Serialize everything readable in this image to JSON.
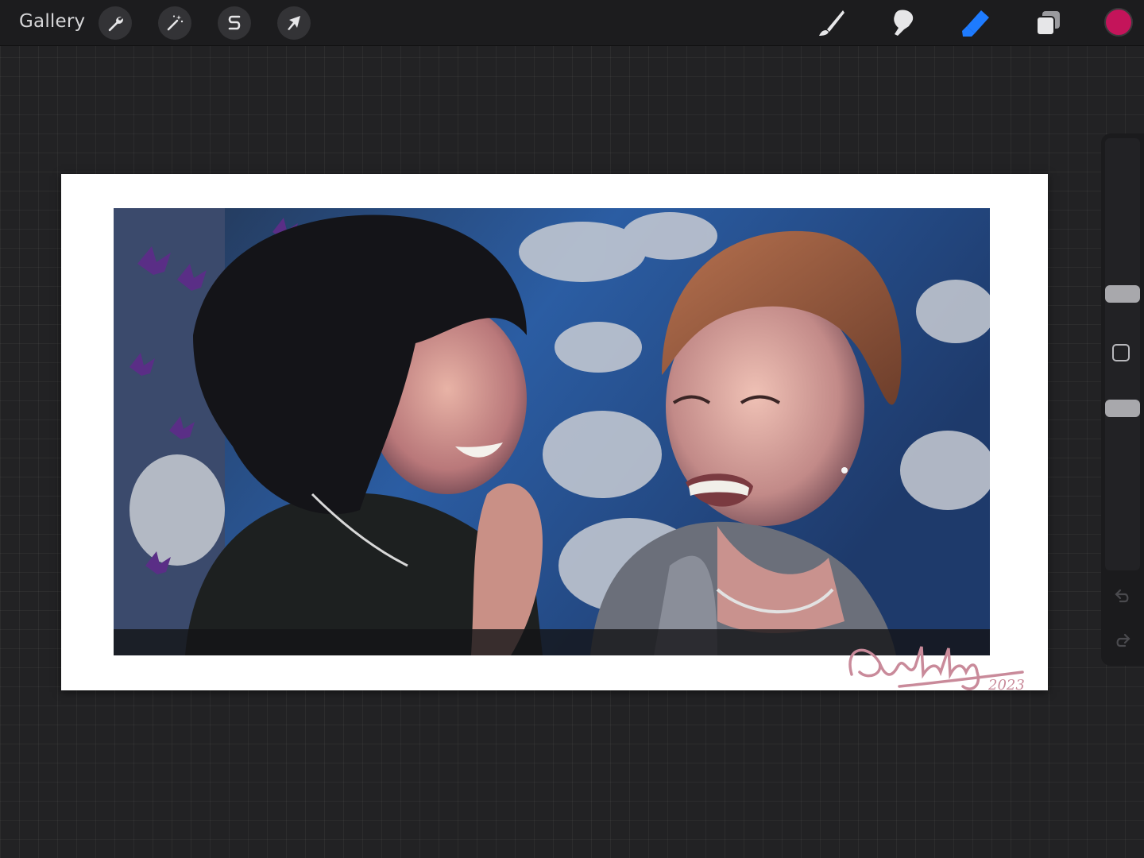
{
  "topbar": {
    "gallery_label": "Gallery",
    "left_tools": [
      {
        "icon": "wrench-icon",
        "name": "actions"
      },
      {
        "icon": "magic-wand-icon",
        "name": "adjustments"
      },
      {
        "icon": "selection-s-icon",
        "name": "selection"
      },
      {
        "icon": "arrow-cursor-icon",
        "name": "transform"
      }
    ],
    "right_tools": [
      {
        "icon": "brush-icon",
        "name": "paint",
        "active": false
      },
      {
        "icon": "smudge-icon",
        "name": "smudge",
        "active": false
      },
      {
        "icon": "eraser-icon",
        "name": "erase",
        "active": true
      },
      {
        "icon": "layers-icon",
        "name": "layers",
        "active": false
      }
    ],
    "current_color": "#c4145a"
  },
  "colors": {
    "active_tool": "#1e7bff",
    "inactive_tool": "#e6e6e8",
    "toolbar_bg": "#1c1c1e",
    "canvas_bg": "#ffffff"
  },
  "canvas": {
    "signature_text": "Abby",
    "signature_year": "2023",
    "signature_color": "#c98a9a"
  },
  "sidebar": {
    "brush_size_level": 0.36,
    "opacity_level": 0.62,
    "undo_icon": "undo-icon",
    "redo_icon": "redo-icon"
  }
}
